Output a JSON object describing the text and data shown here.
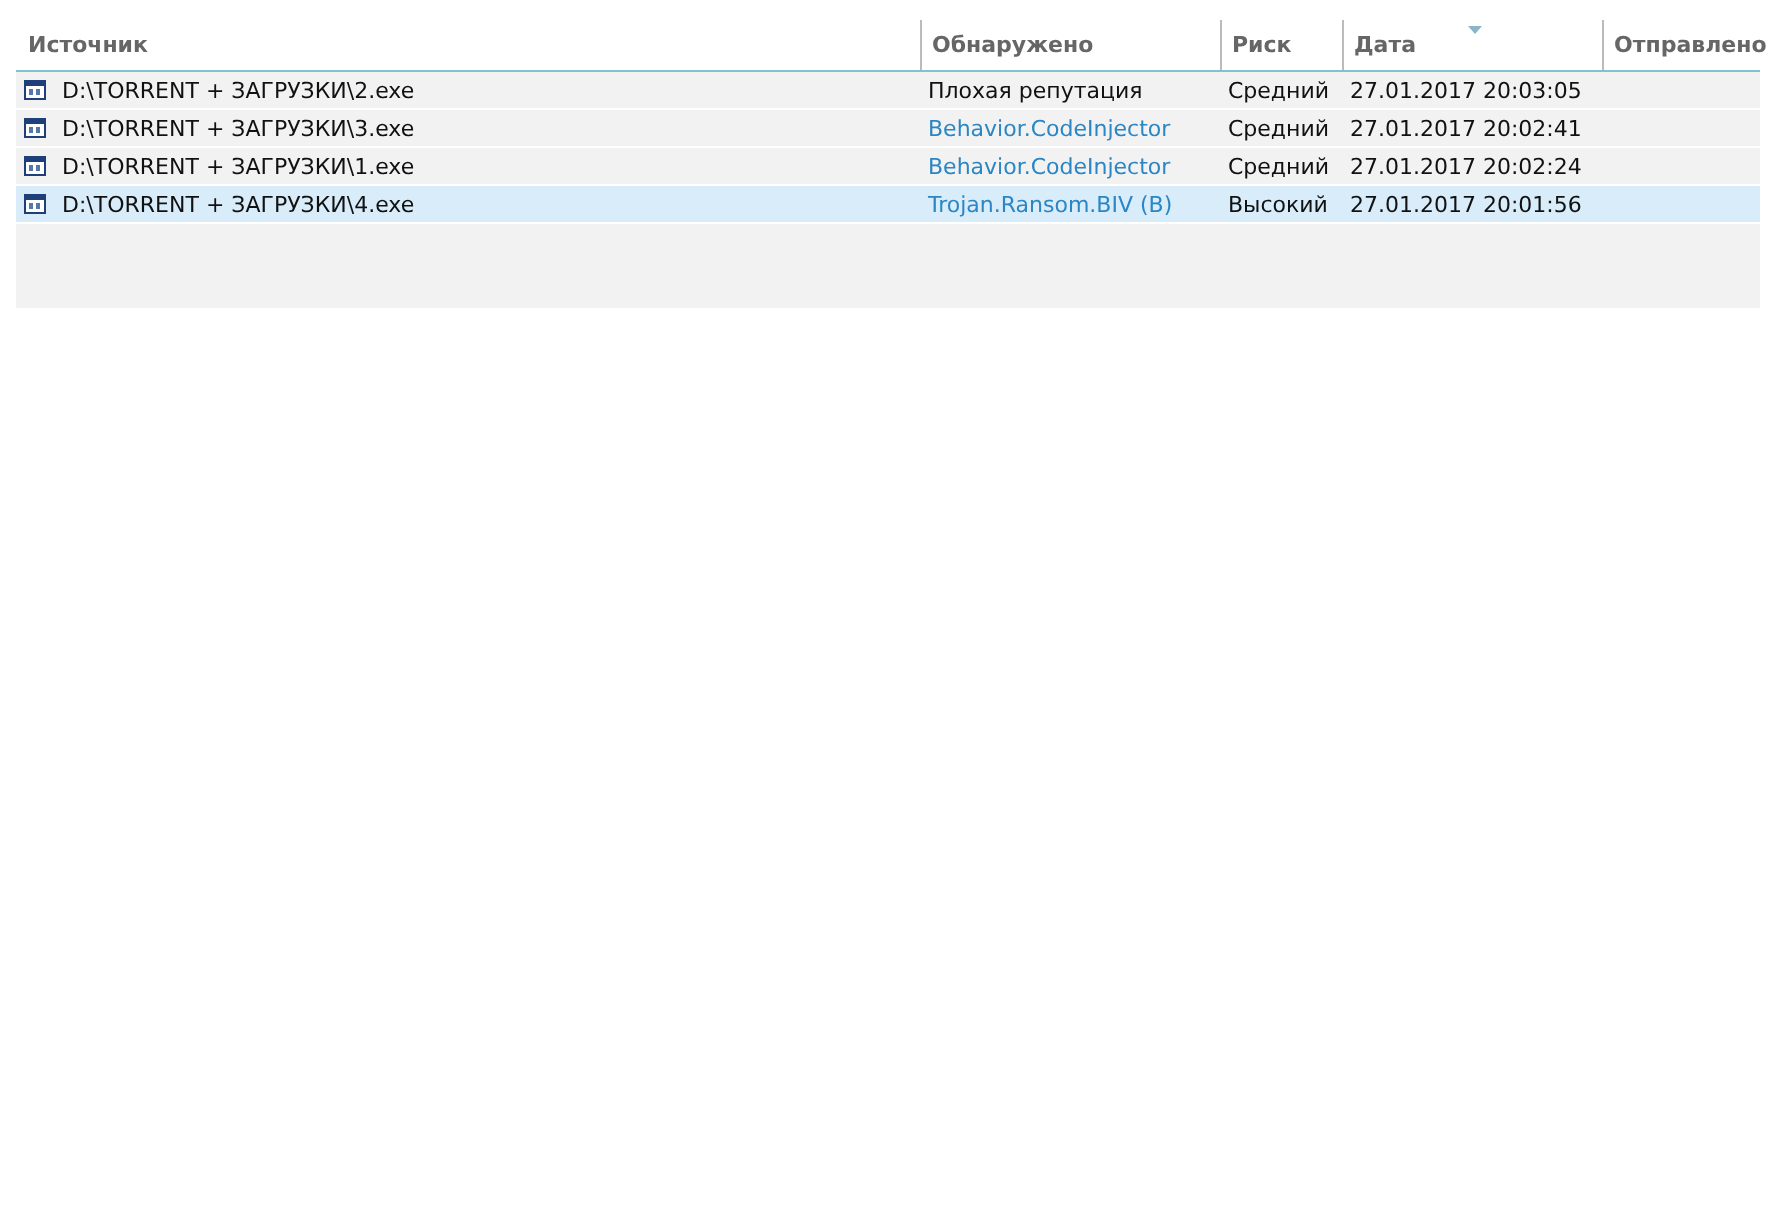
{
  "columns": [
    {
      "label": "Источник",
      "sorted": false
    },
    {
      "label": "Обнаружено",
      "sorted": false
    },
    {
      "label": "Риск",
      "sorted": false
    },
    {
      "label": "Дата",
      "sorted": true
    },
    {
      "label": "Отправлено",
      "sorted": false
    }
  ],
  "rows": [
    {
      "source": "D:\\TORRENT + ЗАГРУЗКИ\\2.exe",
      "detected": {
        "text": "Плохая репутация",
        "kind": "text"
      },
      "risk": "Средний",
      "date": "27.01.2017 20:03:05",
      "selected": false
    },
    {
      "source": "D:\\TORRENT + ЗАГРУЗКИ\\3.exe",
      "detected": {
        "text": "Behavior.CodeInjector",
        "kind": "link"
      },
      "risk": "Средний",
      "date": "27.01.2017 20:02:41",
      "selected": false
    },
    {
      "source": "D:\\TORRENT + ЗАГРУЗКИ\\1.exe",
      "detected": {
        "text": "Behavior.CodeInjector",
        "kind": "link"
      },
      "risk": "Средний",
      "date": "27.01.2017 20:02:24",
      "selected": false
    },
    {
      "source": "D:\\TORRENT + ЗАГРУЗКИ\\4.exe",
      "detected": {
        "text": "Trojan.Ransom.BIV (B)",
        "kind": "link"
      },
      "risk": "Высокий",
      "date": "27.01.2017 20:01:56",
      "selected": true
    }
  ]
}
